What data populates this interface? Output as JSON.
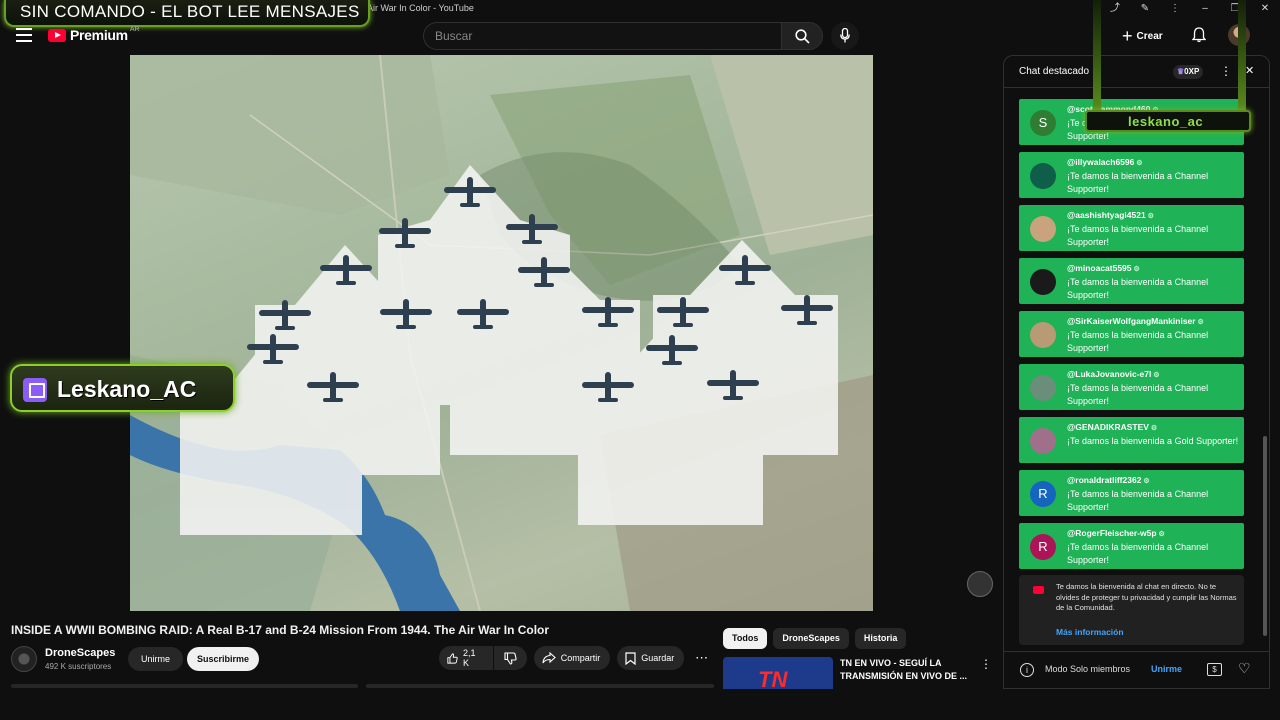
{
  "window": {
    "title": "INSIDE A WWII BOMBING RAID: A Real B-17 and B-24 Mission From 1944. The Air War In Color - YouTube",
    "title_visible": "e Air War In Color - YouTube"
  },
  "overlay": {
    "banner": "SIN COMANDO -  EL BOT LEE MENSAJES",
    "streamer": "Leskano_AC",
    "chat_tag": "leskano_ac"
  },
  "nav": {
    "brand": "Premium",
    "region": "AR",
    "search_placeholder": "Buscar",
    "create_label": "Crear"
  },
  "video": {
    "title": "INSIDE A WWII BOMBING RAID: A Real B-17 and B-24 Mission From 1944. The Air War In Color",
    "channel": "DroneScapes",
    "subscribers": "492 K suscriptores",
    "join_label": "Unirme",
    "subscribe_label": "Suscribirme",
    "likes": "2,1 K",
    "share_label": "Compartir",
    "save_label": "Guardar"
  },
  "related": {
    "chips": [
      "Todos",
      "DroneScapes",
      "Historia"
    ],
    "first_title": "TN EN VIVO - SEGUÍ LA TRANSMISIÓN EN VIVO DE ...",
    "first_logo": "TN"
  },
  "chat": {
    "header": "Chat destacado",
    "xp": "0XP",
    "messages": [
      {
        "user": "@scotthammond460",
        "text": "¡Te damos la bienvenida a Channel Supporter!",
        "avatar_letter": "S",
        "avatar_color": "#2e7d32"
      },
      {
        "user": "@illywalach6596",
        "text": "¡Te damos la bienvenida a Channel Supporter!",
        "avatar_letter": "",
        "avatar_color": "#0e5e4a"
      },
      {
        "user": "@aashishtyagi4521",
        "text": "¡Te damos la bienvenida a Channel Supporter!",
        "avatar_letter": "",
        "avatar_color": "#c9a27e"
      },
      {
        "user": "@minoacat5595",
        "text": "¡Te damos la bienvenida a Channel Supporter!",
        "avatar_letter": "",
        "avatar_color": "#1a1a1a"
      },
      {
        "user": "@SirKaiserWolfgangMankiniser",
        "text": "¡Te damos la bienvenida a Channel Supporter!",
        "avatar_letter": "",
        "avatar_color": "#b89a74"
      },
      {
        "user": "@LukaJovanovic-e7l",
        "text": "¡Te damos la bienvenida a Channel Supporter!",
        "avatar_letter": "",
        "avatar_color": "#6b8e7a"
      },
      {
        "user": "@GENADIKRASTEV",
        "text": "¡Te damos la bienvenida a Gold Supporter!",
        "avatar_letter": "",
        "avatar_color": "#a0708a"
      },
      {
        "user": "@ronaldratliff2362",
        "text": "¡Te damos la bienvenida a Channel Supporter!",
        "avatar_letter": "R",
        "avatar_color": "#1565c0"
      },
      {
        "user": "@RogerFleischer-w5p",
        "text": "¡Te damos la bienvenida a Channel Supporter!",
        "avatar_letter": "R",
        "avatar_color": "#ad1457"
      }
    ],
    "system_message": "Te damos la bienvenida al chat en directo. No te olvides de proteger tu privacidad y cumplir las Normas de la Comunidad.",
    "more_info": "Más información",
    "mode": "Modo Solo miembros",
    "join_label": "Unirme"
  }
}
